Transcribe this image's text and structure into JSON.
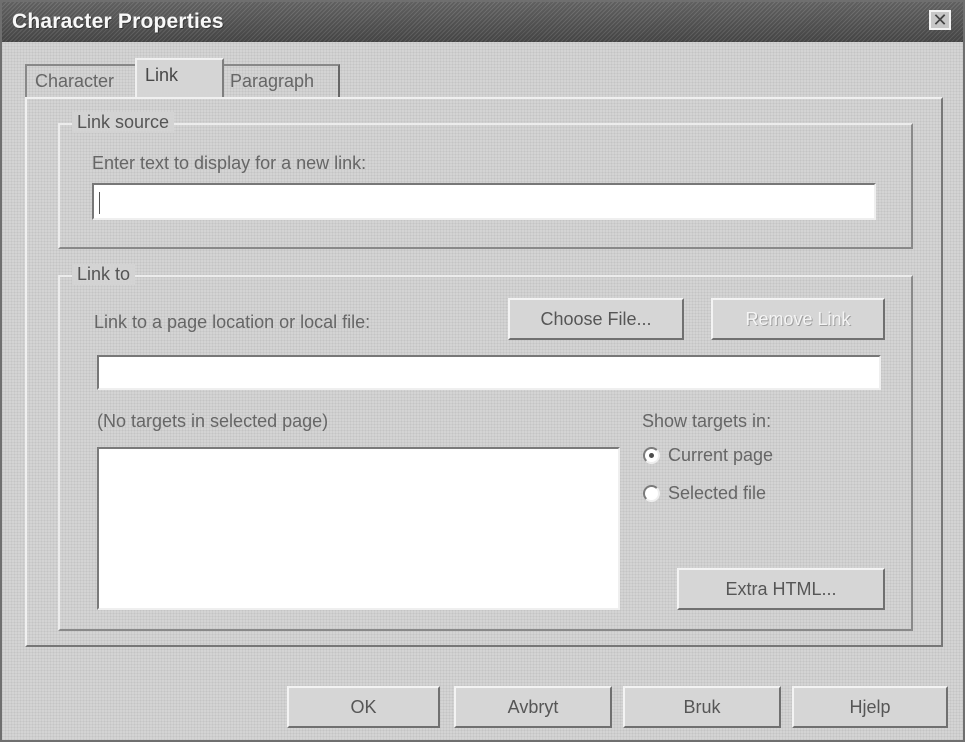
{
  "window": {
    "title": "Character Properties",
    "close_symbol": "✕"
  },
  "tabs": [
    {
      "label": "Character"
    },
    {
      "label": "Link"
    },
    {
      "label": "Paragraph"
    }
  ],
  "link_source": {
    "legend": "Link source",
    "prompt": "Enter text to display for a new link:",
    "value": ""
  },
  "link_to": {
    "legend": "Link to",
    "prompt": "Link to a page location or local file:",
    "value": "",
    "choose_file_button": "Choose File...",
    "remove_link_button": "Remove Link",
    "targets_label": "(No targets in selected page)",
    "show_targets_label": "Show targets in:",
    "radio_current": "Current page",
    "radio_selected": "Selected file",
    "extra_html_button": "Extra HTML..."
  },
  "buttons": {
    "ok": "OK",
    "cancel": "Avbryt",
    "apply": "Bruk",
    "help": "Hjelp"
  },
  "colors": {
    "titlebar": "#555555",
    "dialog_background": "#d2d2d2",
    "text_field": "#ffffff"
  },
  "icons": {
    "close": "close-icon"
  }
}
